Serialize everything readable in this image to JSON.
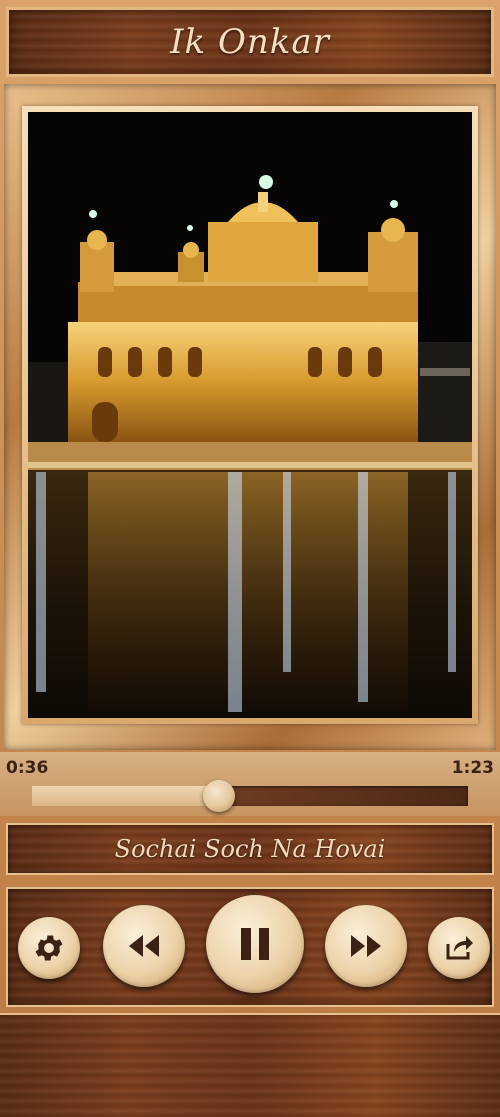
{
  "app": {
    "title": "Ik Onkar"
  },
  "artwork": {
    "icon": "golden-temple-image"
  },
  "player": {
    "current_time": "0:36",
    "total_time": "1:23",
    "progress_fraction": 0.43,
    "track_title": "Sochai Soch Na Hovai",
    "is_playing": true
  },
  "controls": {
    "settings_icon": "gear-icon",
    "rewind_icon": "rewind-icon",
    "pause_icon": "pause-icon",
    "forward_icon": "fast-forward-icon",
    "share_icon": "share-icon"
  },
  "colors": {
    "wood_dark": "#5a2c14",
    "cream_text": "#f6e0c2",
    "button_face": "#ecd2a8",
    "icon_dark": "#3b2212"
  }
}
